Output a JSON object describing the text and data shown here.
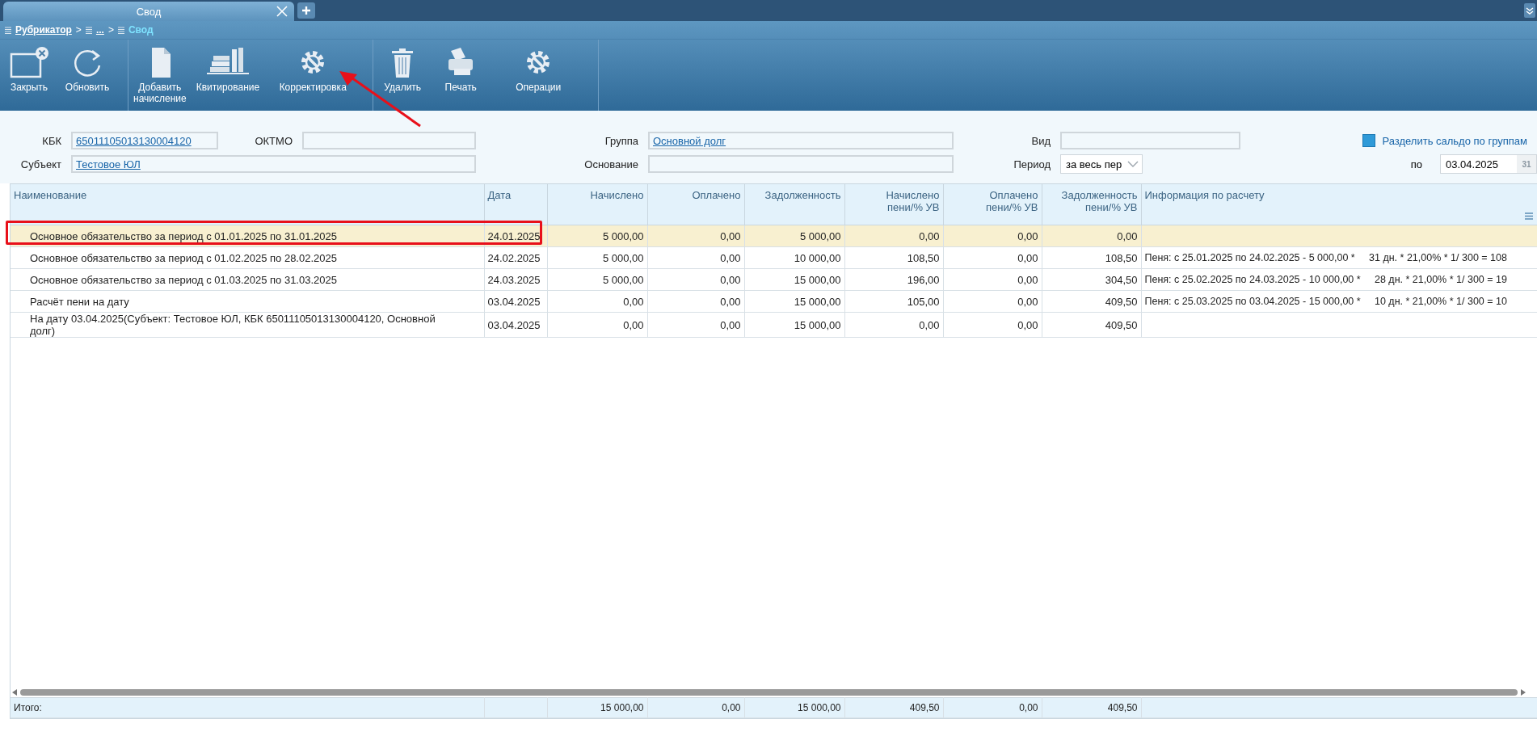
{
  "tabs": [
    {
      "label": "Свод",
      "selected": true
    }
  ],
  "breadcrumb": [
    {
      "label": "Рубрикатор",
      "current": false,
      "separator": ">"
    },
    {
      "label": "...",
      "current": false,
      "separator": ">"
    },
    {
      "label": "Свод",
      "current": true
    }
  ],
  "toolbar": [
    [
      {
        "label": "Закрыть",
        "kind": "close"
      },
      {
        "label": "Обновить",
        "kind": "refresh"
      }
    ],
    [
      {
        "label": "Добавить начисление",
        "kind": "document"
      },
      {
        "label": "Квитирование",
        "kind": "books"
      },
      {
        "label": "Корректировка",
        "kind": "gear-wrench"
      }
    ],
    [
      {
        "label": "Удалить",
        "kind": "trash"
      },
      {
        "label": "Печать",
        "kind": "printer"
      },
      {
        "label": "Операции",
        "kind": "gear-wrench"
      }
    ]
  ],
  "filters": {
    "kbk": {
      "label": "КБК",
      "value": "65011105013130004120"
    },
    "oktmo": {
      "label": "ОКТМО"
    },
    "group": {
      "label": "Группа",
      "value": "Основной долг"
    },
    "kind": {
      "label": "Вид"
    },
    "subject": {
      "label": "Субъект",
      "value": "Тестовое ЮЛ"
    },
    "basis": {
      "label": "Основание"
    },
    "period": {
      "label": "Период",
      "value": "за весь пер"
    },
    "split_by_groups": {
      "label": "Разделить сальдо по группам",
      "checked": false
    },
    "date_to": {
      "label": "по",
      "value": "03.04.2025",
      "calendar_icon": "31"
    }
  },
  "table": {
    "columns": [
      {
        "label": "Наименование",
        "kind": "text"
      },
      {
        "label": "Дата",
        "kind": "text"
      },
      {
        "label": "Начислено",
        "kind": "number"
      },
      {
        "label": "Оплачено",
        "kind": "number"
      },
      {
        "label": "Задолженность",
        "kind": "number"
      },
      {
        "label": "Начислено пени/% УВ",
        "kind": "number"
      },
      {
        "label": "Оплачено пени/% УВ",
        "kind": "number"
      },
      {
        "label": "Задолженность пени/% УВ",
        "kind": "number"
      },
      {
        "label": "Информация по расчету",
        "kind": "text"
      }
    ],
    "rows": [
      {
        "selected": true,
        "outlined": true,
        "cells": [
          "Основное обязательство за период с 01.01.2025 по 31.01.2025",
          "24.01.2025",
          "5 000,00",
          "0,00",
          "5 000,00",
          "0,00",
          "0,00",
          "0,00",
          null
        ]
      },
      {
        "selected": false,
        "outlined": false,
        "cells": [
          "Основное обязательство за период с 01.02.2025 по 28.02.2025",
          "24.02.2025",
          "5 000,00",
          "0,00",
          "10 000,00",
          "108,50",
          "0,00",
          "108,50",
          "Пеня: с 25.01.2025 по 24.02.2025 - 5 000,00 *     31 дн. * 21,00% * 1/ 300 = 108"
        ]
      },
      {
        "selected": false,
        "outlined": false,
        "cells": [
          "Основное обязательство за период с 01.03.2025 по 31.03.2025",
          "24.03.2025",
          "5 000,00",
          "0,00",
          "15 000,00",
          "196,00",
          "0,00",
          "304,50",
          "Пеня: с 25.02.2025 по 24.03.2025 - 10 000,00 *     28 дн. * 21,00% * 1/ 300 = 19"
        ]
      },
      {
        "selected": false,
        "outlined": false,
        "cells": [
          "Расчёт пени на дату",
          "03.04.2025",
          "0,00",
          "0,00",
          "15 000,00",
          "105,00",
          "0,00",
          "409,50",
          "Пеня: с 25.03.2025 по 03.04.2025 - 15 000,00 *     10 дн. * 21,00% * 1/ 300 = 10"
        ]
      },
      {
        "selected": false,
        "outlined": false,
        "cells": [
          "На дату 03.04.2025(Субъект: Тестовое ЮЛ, КБК 65011105013130004120, Основной долг)",
          "03.04.2025",
          "0,00",
          "0,00",
          "15 000,00",
          "0,00",
          "0,00",
          "409,50",
          null
        ]
      }
    ],
    "totals": {
      "label": "Итого:",
      "values": [
        "15 000,00",
        "0,00",
        "15 000,00",
        "409,50",
        "0,00",
        "409,50"
      ]
    }
  }
}
